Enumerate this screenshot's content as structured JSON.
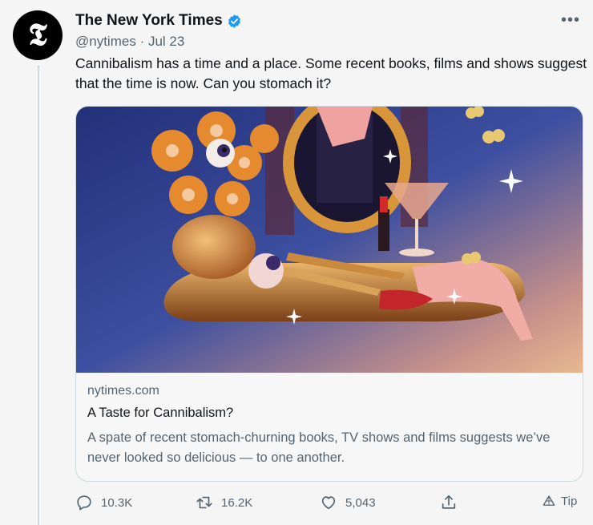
{
  "tweet": {
    "author_name": "The New York Times",
    "handle": "@nytimes",
    "separator": "·",
    "date": "Jul 23",
    "avatar_letter": "𝕿",
    "more_label": "•••",
    "text": "Cannibalism has a time and a place. Some recent books, films and shows suggest that the time is now. Can you stomach it?"
  },
  "card": {
    "domain": "nytimes.com",
    "title": "A Taste for Cannibalism?",
    "description": "A spate of recent stomach-churning books, TV shows and films suggests we’ve never looked so delicious — to one another."
  },
  "actions": {
    "reply_count": "10.3K",
    "retweet_count": "16.2K",
    "like_count": "5,043",
    "tip_label": "Tip"
  },
  "colors": {
    "verified": "#1d9bf0",
    "secondary_text": "#536471",
    "border": "#cfd9de"
  },
  "icons": [
    "verified-badge-icon",
    "more-icon",
    "reply-icon",
    "retweet-icon",
    "like-icon",
    "share-icon",
    "tip-icon"
  ]
}
